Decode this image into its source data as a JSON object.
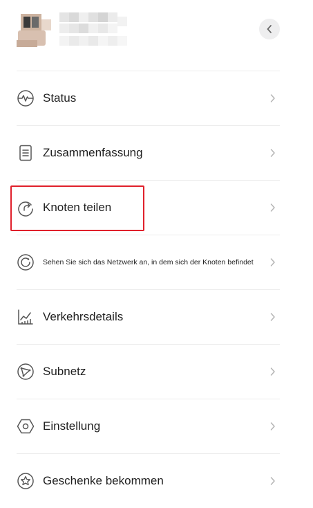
{
  "header": {
    "device_name_redacted": true,
    "back_icon": "chevron-left-icon"
  },
  "menu": {
    "items": [
      {
        "id": "status",
        "label": "Status",
        "icon": "heartbeat-icon"
      },
      {
        "id": "zusammenfassung",
        "label": "Zusammenfassung",
        "icon": "document-icon"
      },
      {
        "id": "knoten-teilen",
        "label": "Knoten teilen",
        "icon": "share-arrow-icon",
        "highlighted": true
      },
      {
        "id": "netzwerk",
        "label": "Sehen Sie sich das Netzwerk an, in dem sich der Knoten befindet",
        "icon": "network-circle-icon"
      },
      {
        "id": "verkehrsdetails",
        "label": "Verkehrsdetails",
        "icon": "chart-icon"
      },
      {
        "id": "subnetz",
        "label": "Subnetz",
        "icon": "subnet-icon"
      },
      {
        "id": "einstellung",
        "label": "Einstellung",
        "icon": "hexagon-settings-icon"
      },
      {
        "id": "geschenke",
        "label": "Geschenke bekommen",
        "icon": "star-icon"
      }
    ]
  },
  "colors": {
    "highlight": "#e0202b",
    "divider": "#ececec",
    "icon": "#555555",
    "chevron": "#b5b5b5"
  }
}
